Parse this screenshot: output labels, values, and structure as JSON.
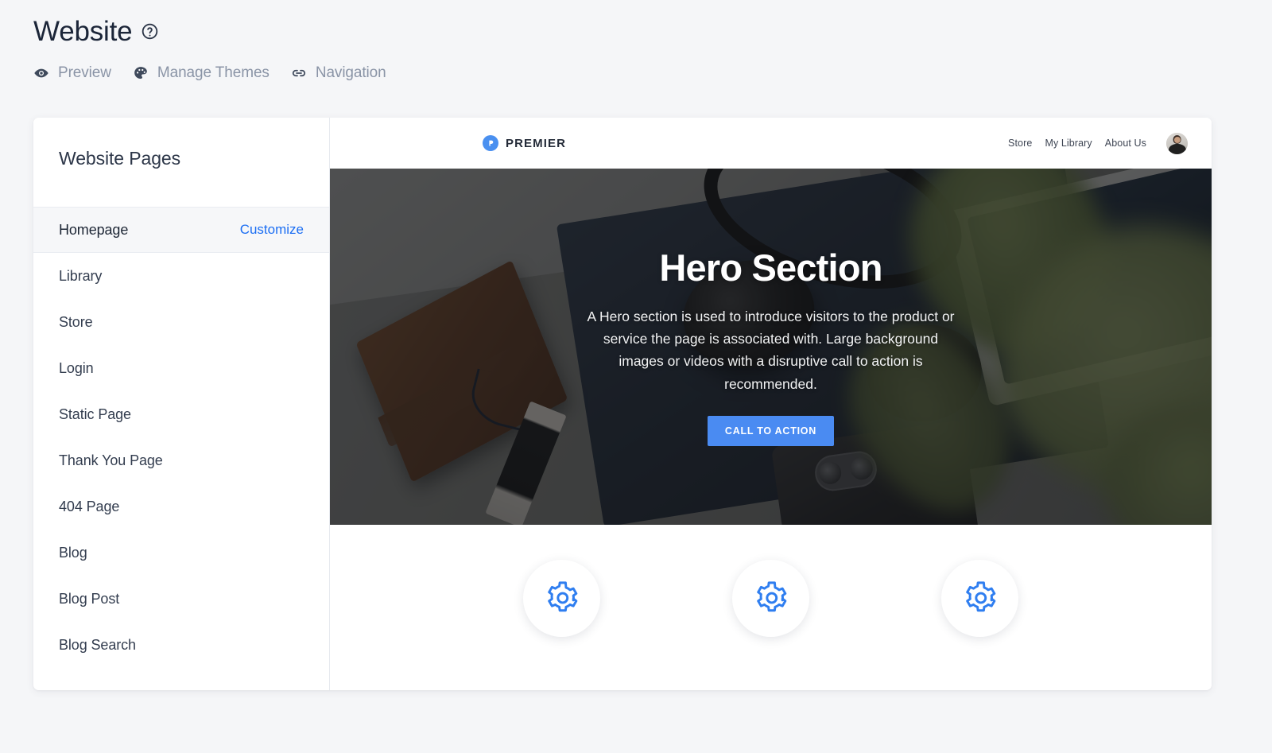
{
  "header": {
    "title": "Website",
    "help_icon": "help-circle-icon",
    "toolbar": [
      {
        "label": "Preview",
        "icon": "eye-icon"
      },
      {
        "label": "Manage Themes",
        "icon": "palette-icon"
      },
      {
        "label": "Navigation",
        "icon": "link-icon"
      }
    ]
  },
  "sidebar": {
    "title": "Website Pages",
    "customize_label": "Customize",
    "items": [
      {
        "label": "Homepage",
        "active": true
      },
      {
        "label": "Library",
        "active": false
      },
      {
        "label": "Store",
        "active": false
      },
      {
        "label": "Login",
        "active": false
      },
      {
        "label": "Static Page",
        "active": false
      },
      {
        "label": "Thank You Page",
        "active": false
      },
      {
        "label": "404 Page",
        "active": false
      },
      {
        "label": "Blog",
        "active": false
      },
      {
        "label": "Blog Post",
        "active": false
      },
      {
        "label": "Blog Search",
        "active": false
      }
    ]
  },
  "preview": {
    "site_nav": {
      "brand_name": "PREMIER",
      "brand_icon": "premier-logo-icon",
      "links": [
        "Store",
        "My Library",
        "About Us"
      ],
      "avatar": "user-avatar"
    },
    "hero": {
      "title": "Hero Section",
      "subtitle": "A Hero section is used to introduce visitors to the product or service the page is associated with. Large background images or videos with a disruptive call to action is recommended.",
      "cta_label": "CALL TO ACTION",
      "cta_color": "#4a8bf2",
      "background": "desk-photo-headphones-wallet-phone-plant"
    },
    "features": [
      {
        "icon": "gear-icon",
        "color": "#2f7ef0"
      },
      {
        "icon": "gear-icon",
        "color": "#2f7ef0"
      },
      {
        "icon": "gear-icon",
        "color": "#2f7ef0"
      }
    ]
  },
  "colors": {
    "page_background": "#f5f6f8",
    "accent_link": "#1b6ef3",
    "accent_blue": "#4a8bf2",
    "text_dark": "#1b2538",
    "text_muted": "#8a94a6"
  }
}
